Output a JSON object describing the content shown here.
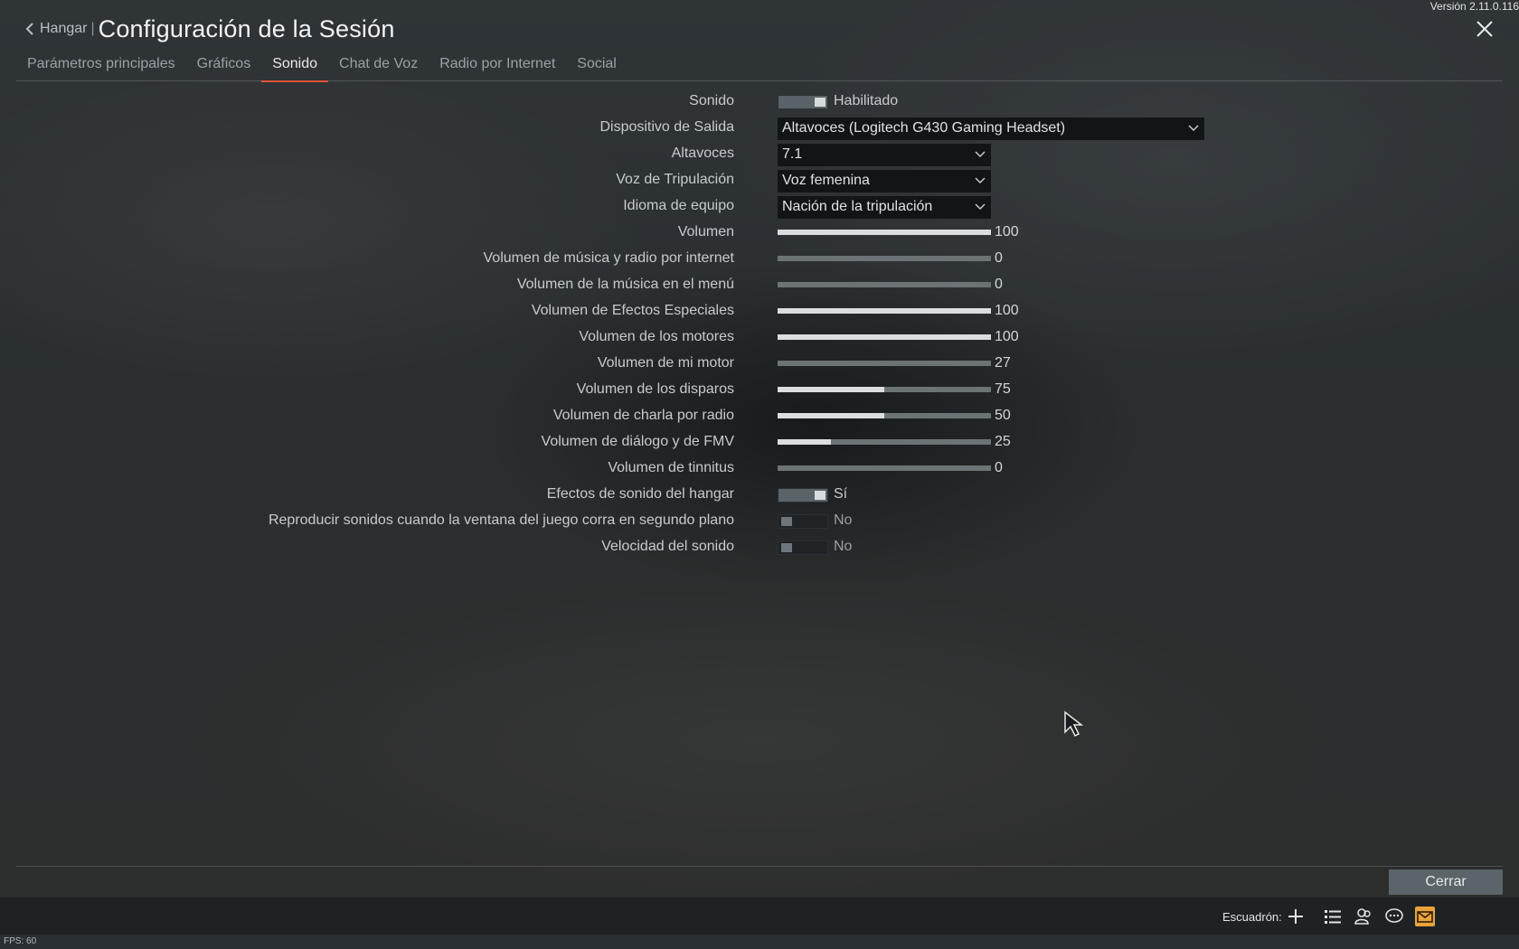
{
  "version": "Versión 2.11.0.116",
  "header": {
    "back_label": "Hangar",
    "separator": "|",
    "title": "Configuración de la Sesión"
  },
  "tabs": [
    {
      "label": "Parámetros principales",
      "active": false
    },
    {
      "label": "Gráficos",
      "active": false
    },
    {
      "label": "Sonido",
      "active": true
    },
    {
      "label": "Chat de Voz",
      "active": false
    },
    {
      "label": "Radio por Internet",
      "active": false
    },
    {
      "label": "Social",
      "active": false
    }
  ],
  "settings": {
    "sonido": {
      "label": "Sonido",
      "state": "on",
      "value": "Habilitado"
    },
    "dispositivo": {
      "label": "Dispositivo de Salida",
      "value": "Altavoces (Logitech G430 Gaming Headset)"
    },
    "altavoces": {
      "label": "Altavoces",
      "value": "7.1"
    },
    "voz_tripulacion": {
      "label": "Voz de Tripulación",
      "value": "Voz femenina"
    },
    "idioma_equipo": {
      "label": "Idioma de equipo",
      "value": "Nación de la tripulación"
    },
    "volumen": {
      "label": "Volumen",
      "value": "100",
      "fraction": 1.0
    },
    "vol_musica_radio": {
      "label": "Volumen de música y radio por internet",
      "value": "0",
      "fraction": 0
    },
    "vol_musica_menu": {
      "label": "Volumen de la música en el menú",
      "value": "0",
      "fraction": 0
    },
    "vol_efectos": {
      "label": "Volumen de Efectos Especiales",
      "value": "100",
      "fraction": 1.0
    },
    "vol_motores": {
      "label": "Volumen de los motores",
      "value": "100",
      "fraction": 1.0
    },
    "vol_mi_motor": {
      "label": "Volumen de mi motor",
      "value": "27",
      "fraction": 0
    },
    "vol_disparos": {
      "label": "Volumen de los disparos",
      "value": "75",
      "fraction": 0.5
    },
    "vol_charla_radio": {
      "label": "Volumen de charla por radio",
      "value": "50",
      "fraction": 0.5
    },
    "vol_dialogo": {
      "label": "Volumen de diálogo y de FMV",
      "value": "25",
      "fraction": 0.25
    },
    "vol_tinnitus": {
      "label": "Volumen de tinnitus",
      "value": "0",
      "fraction": 0
    },
    "efectos_hangar": {
      "label": "Efectos de sonido del hangar",
      "state": "on",
      "value": "Sí"
    },
    "reproducir_segundo_plano": {
      "label": "Reproducir sonidos cuando la ventana del juego corra en segundo plano",
      "state": "off",
      "value": "No"
    },
    "velocidad_sonido": {
      "label": "Velocidad del sonido",
      "state": "off",
      "value": "No"
    }
  },
  "footer": {
    "close_label": "Cerrar",
    "squad_label": "Escuadrón:",
    "fps": "FPS: 60"
  },
  "colors": {
    "tab_accent": "#e0553a",
    "mail_badge": "#e9a33a"
  },
  "icons": [
    "back-chevron-icon",
    "close-icon",
    "dropdown-chevron-icon",
    "plus-icon",
    "list-icon",
    "friends-icon",
    "chat-icon",
    "mail-icon",
    "mouse-cursor-icon"
  ]
}
